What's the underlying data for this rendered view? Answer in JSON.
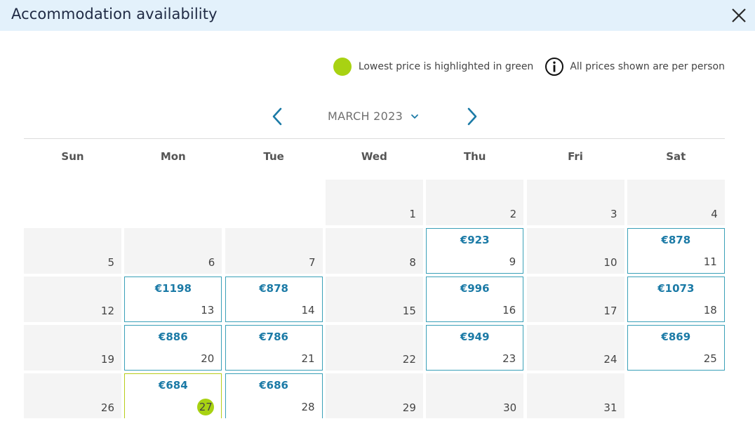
{
  "header": {
    "title": "Accommodation availability"
  },
  "legend": {
    "lowest_text": "Lowest price is highlighted in green",
    "per_person_text": "All prices shown are per person",
    "lowest_color": "#a8d212"
  },
  "calendar": {
    "month_label": "MARCH 2023",
    "weekdays": [
      "Sun",
      "Mon",
      "Tue",
      "Wed",
      "Thu",
      "Fri",
      "Sat"
    ],
    "days": [
      {
        "day": "1"
      },
      {
        "day": "2"
      },
      {
        "day": "3"
      },
      {
        "day": "4"
      },
      {
        "day": "5"
      },
      {
        "day": "6"
      },
      {
        "day": "7"
      },
      {
        "day": "8"
      },
      {
        "day": "9",
        "price": "€923"
      },
      {
        "day": "10"
      },
      {
        "day": "11",
        "price": "€878"
      },
      {
        "day": "12"
      },
      {
        "day": "13",
        "price": "€1198"
      },
      {
        "day": "14",
        "price": "€878"
      },
      {
        "day": "15"
      },
      {
        "day": "16",
        "price": "€996"
      },
      {
        "day": "17"
      },
      {
        "day": "18",
        "price": "€1073"
      },
      {
        "day": "19"
      },
      {
        "day": "20",
        "price": "€886"
      },
      {
        "day": "21",
        "price": "€786"
      },
      {
        "day": "22"
      },
      {
        "day": "23",
        "price": "€949"
      },
      {
        "day": "24"
      },
      {
        "day": "25",
        "price": "€869"
      },
      {
        "day": "26"
      },
      {
        "day": "27",
        "price": "€684",
        "lowest": true
      },
      {
        "day": "28",
        "price": "€686"
      },
      {
        "day": "29"
      },
      {
        "day": "30"
      },
      {
        "day": "31"
      }
    ],
    "first_weekday_index": 3
  },
  "colors": {
    "header_bg": "#e3f1fb",
    "price_text": "#1b7aa6",
    "priced_border": "#3aa0b8",
    "empty_cell_bg": "#f4f4f4"
  }
}
